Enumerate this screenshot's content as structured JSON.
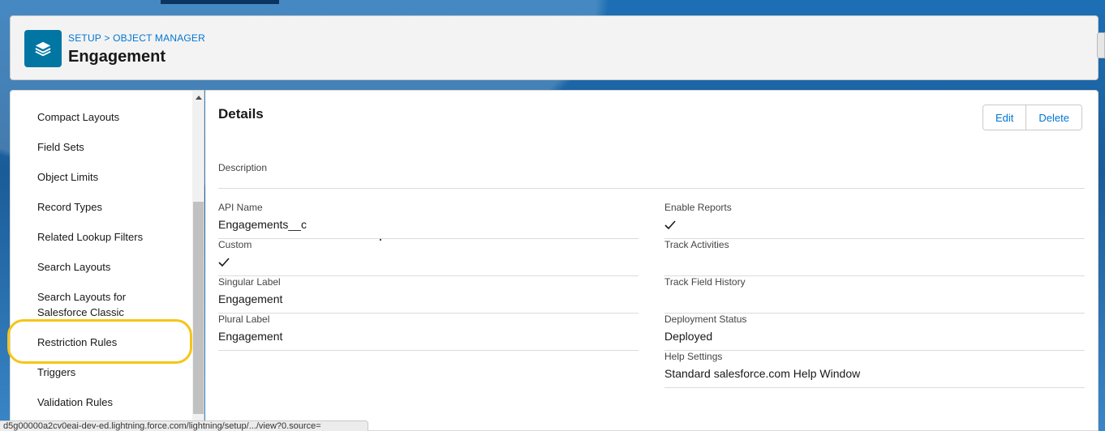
{
  "header": {
    "breadcrumb": "SETUP > OBJECT MANAGER",
    "title": "Engagement",
    "icon": "layers-icon"
  },
  "sidebar": {
    "items": [
      {
        "label": "Compact Layouts"
      },
      {
        "label": "Field Sets"
      },
      {
        "label": "Object Limits"
      },
      {
        "label": "Record Types"
      },
      {
        "label": "Related Lookup Filters"
      },
      {
        "label": "Search Layouts"
      },
      {
        "label": "Search Layouts for Salesforce Classic"
      },
      {
        "label": "Restriction Rules"
      },
      {
        "label": "Triggers"
      },
      {
        "label": "Validation Rules"
      }
    ],
    "highlighted_item": "Restriction Rules",
    "highlight_color": "#f5c518"
  },
  "details": {
    "title": "Details",
    "edit_label": "Edit",
    "delete_label": "Delete",
    "description_label": "Description",
    "fields": {
      "api_name": {
        "label": "API Name",
        "value": "Engagements__c"
      },
      "custom": {
        "label": "Custom",
        "checked": true
      },
      "singular_label": {
        "label": "Singular Label",
        "value": "Engagement"
      },
      "plural_label": {
        "label": "Plural Label",
        "value": "Engagement"
      },
      "enable_reports": {
        "label": "Enable Reports",
        "checked": true
      },
      "track_activities": {
        "label": "Track Activities",
        "checked": false
      },
      "track_field_history": {
        "label": "Track Field History",
        "checked": false
      },
      "deployment_status": {
        "label": "Deployment Status",
        "value": "Deployed"
      },
      "help_settings": {
        "label": "Help Settings",
        "value": "Standard salesforce.com Help Window"
      }
    }
  },
  "status_bar": {
    "url": "d5g00000a2cv0eai-dev-ed.lightning.force.com/lightning/setup/.../view?0.source="
  },
  "colors": {
    "brand_blue": "#0176d3",
    "icon_bg": "#0176a3",
    "highlight": "#f5c518"
  }
}
